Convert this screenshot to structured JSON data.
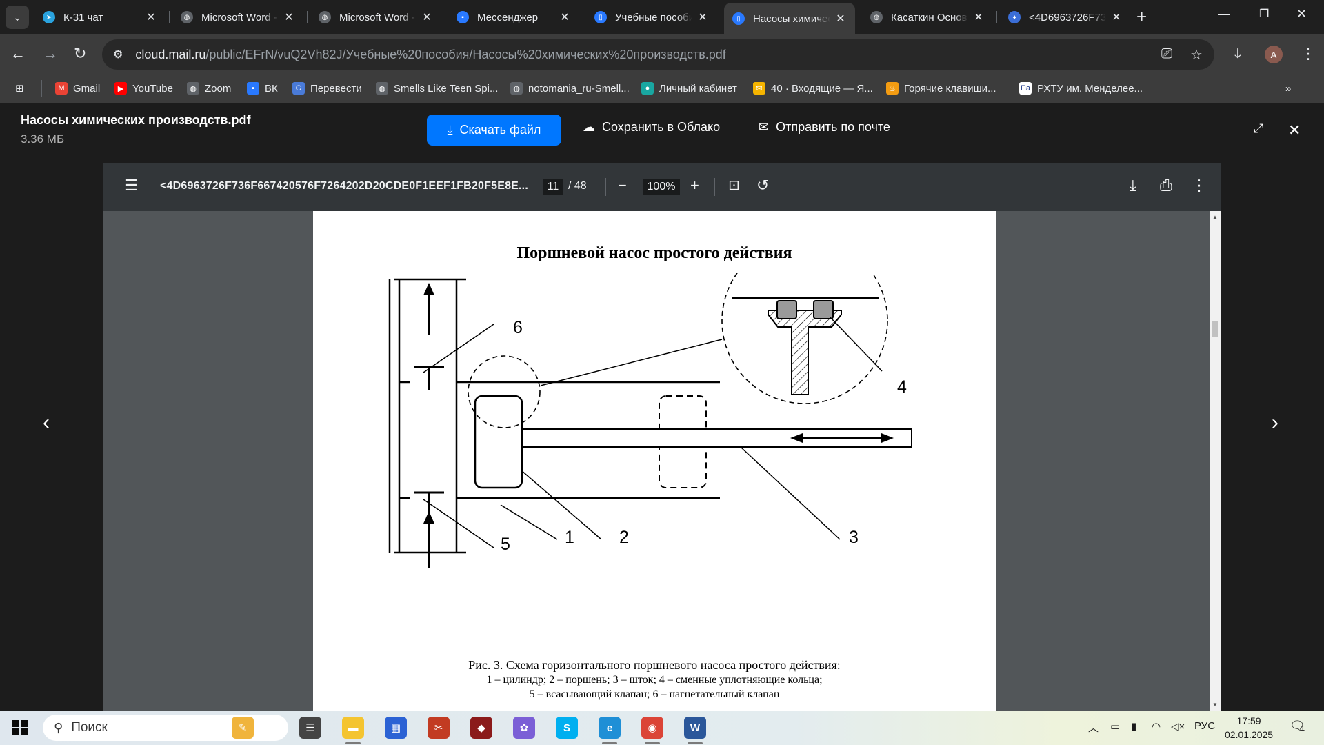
{
  "browser": {
    "tabs": [
      {
        "title": "К-31 чат",
        "icon": "telegram-icon",
        "color": "#2aa3df",
        "glyph": "➤"
      },
      {
        "title": "Microsoft Word -",
        "icon": "globe-icon",
        "color": "#5f6368",
        "glyph": "◍"
      },
      {
        "title": "Microsoft Word -",
        "icon": "globe-icon",
        "color": "#5f6368",
        "glyph": "◍"
      },
      {
        "title": "Мессенджер",
        "icon": "messenger-icon",
        "color": "#2979ff",
        "glyph": "▪"
      },
      {
        "title": "Учебные пособия",
        "icon": "cloud-doc-icon",
        "color": "#2979ff",
        "glyph": "▯"
      },
      {
        "title": "Насосы химичес",
        "icon": "cloud-doc-icon",
        "color": "#2979ff",
        "glyph": "▯"
      },
      {
        "title": "Касаткин Основ",
        "icon": "globe-icon",
        "color": "#5f6368",
        "glyph": "◍"
      },
      {
        "title": "<4D6963726F73",
        "icon": "pdf-drop-icon",
        "color": "#3b6ed6",
        "glyph": "♦"
      }
    ],
    "active_tab_index": 5,
    "omnibox": {
      "domain": "cloud.mail.ru",
      "path": "/public/EFrN/vuQ2Vh82J/Учебные%20пособия/Насосы%20химических%20производств.pdf"
    },
    "avatar_letter": "A",
    "bookmarks": [
      {
        "label": "Gmail",
        "icon": "gmail-icon",
        "color": "#ea4335",
        "glyph": "M"
      },
      {
        "label": "YouTube",
        "icon": "youtube-icon",
        "color": "#ff0000",
        "glyph": "▶"
      },
      {
        "label": "Zoom",
        "icon": "globe-icon",
        "color": "#5f6368",
        "glyph": "◍"
      },
      {
        "label": "ВК",
        "icon": "vk-icon",
        "color": "#2979ff",
        "glyph": "▪"
      },
      {
        "label": "Перевести",
        "icon": "translate-icon",
        "color": "#4a7bd8",
        "glyph": "G"
      },
      {
        "label": "Smells Like Teen Spi...",
        "icon": "globe-icon",
        "color": "#5f6368",
        "glyph": "◍"
      },
      {
        "label": "notomania_ru-Smell...",
        "icon": "globe-icon",
        "color": "#5f6368",
        "glyph": "◍"
      },
      {
        "label": "Личный кабинет",
        "icon": "dots-icon",
        "color": "#19a7a1",
        "glyph": "●"
      },
      {
        "label": "40 · Входящие — Я...",
        "icon": "mail-icon",
        "color": "#f5b400",
        "glyph": "✉"
      },
      {
        "label": "Горячие клавиши...",
        "icon": "flame-icon",
        "color": "#f39c12",
        "glyph": "♨"
      },
      {
        "label": "РХТУ им. Менделее...",
        "icon": "muctr-icon",
        "color": "#ffffff",
        "glyph": "Па"
      }
    ]
  },
  "viewer": {
    "file_name": "Насосы химических производств.pdf",
    "file_size": "3.36 МБ",
    "download_label": "Скачать файл",
    "save_label": "Сохранить в Облако",
    "mail_label": "Отправить по почте",
    "prev_arrow": "‹",
    "next_arrow": "›"
  },
  "pdf": {
    "title": "<4D6963726F736F667420576F7264202D20CDE0F1EEF1FB20F5E8E...",
    "current_page": "11",
    "total_pages": "/ 48",
    "zoom": "100%"
  },
  "page": {
    "title": "Поршневой насос простого действия",
    "figure_labels": {
      "l1": "1",
      "l2": "2",
      "l3": "3",
      "l4": "4",
      "l5": "5",
      "l6": "6"
    },
    "caption_line1": "Рис. 3. Схема горизонтального поршневого насоса простого действия:",
    "caption_line2": "1 – цилиндр; 2 – поршень; 3 – шток; 4 – сменные уплотняющие кольца;",
    "caption_line3": "5 – всасывающий клапан; 6 – нагнетательный клапан"
  },
  "taskbar": {
    "search_label": "Поиск",
    "apps": [
      {
        "icon": "widgets-icon",
        "color": "#f0b43c",
        "glyph": "✎"
      },
      {
        "icon": "task-view-icon",
        "color": "#444444",
        "glyph": "☰"
      },
      {
        "icon": "file-explorer-icon",
        "color": "#f4c430",
        "glyph": "▬"
      },
      {
        "icon": "store-icon",
        "color": "#2b62d4",
        "glyph": "▦"
      },
      {
        "icon": "screen-tool-icon",
        "color": "#c23b22",
        "glyph": "✂"
      },
      {
        "icon": "game-icon",
        "color": "#8b1a1a",
        "glyph": "◆"
      },
      {
        "icon": "copilot-icon",
        "color": "#7b5fd6",
        "glyph": "✿"
      },
      {
        "icon": "skype-icon",
        "color": "#00aff0",
        "glyph": "S"
      },
      {
        "icon": "edge-icon",
        "color": "#1f8fd6",
        "glyph": "e"
      },
      {
        "icon": "chrome-icon",
        "color": "#db4437",
        "glyph": "◉"
      },
      {
        "icon": "word-icon",
        "color": "#2b579a",
        "glyph": "W"
      }
    ],
    "language": "РУС",
    "time": "17:59",
    "date": "02.01.2025",
    "notifications": "1"
  }
}
